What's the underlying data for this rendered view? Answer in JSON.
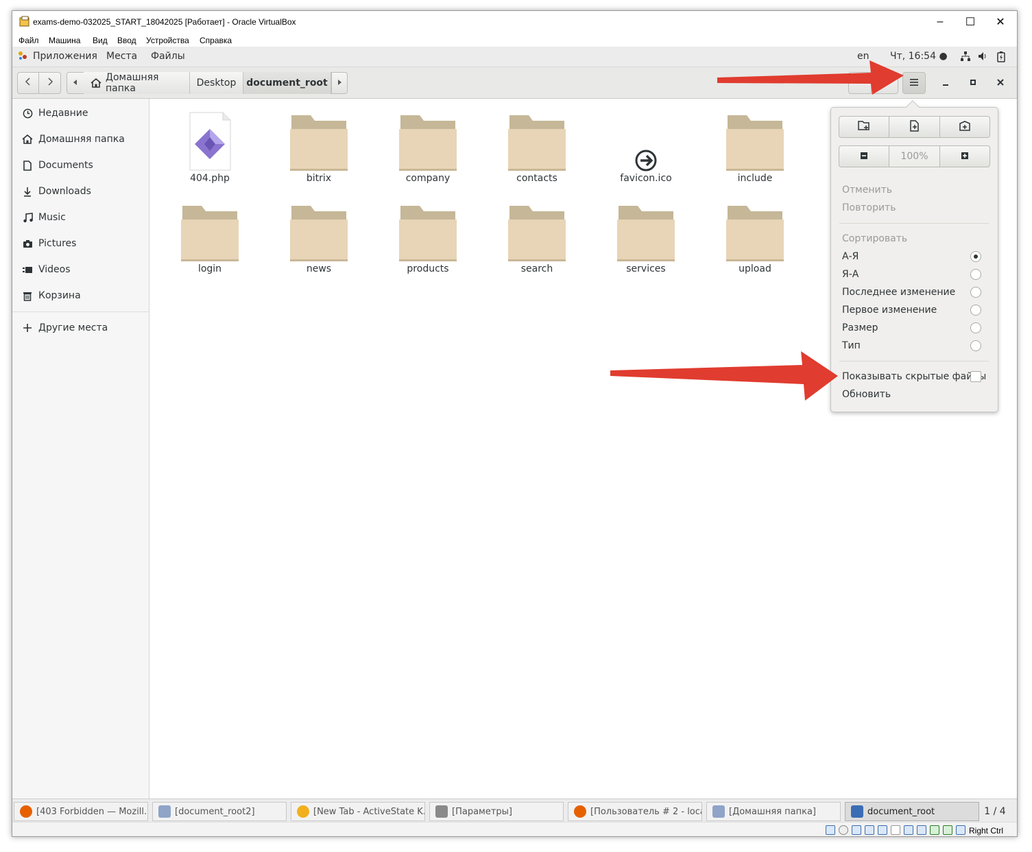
{
  "window": {
    "title": "exams-demo-032025_START_18042025 [Работает] - Oracle VirtualBox",
    "minimize": "–",
    "maximize": "☐",
    "close": "✕"
  },
  "vbox_menu": [
    "Файл",
    "Машина",
    "Вид",
    "Ввод",
    "Устройства",
    "Справка"
  ],
  "topbar": {
    "apps": "Приложения",
    "places": "Места",
    "files": "Файлы",
    "lang": "en",
    "clock": "Чт, 16:54 ●"
  },
  "header": {
    "crumbs": [
      "Домашняя папка",
      "Desktop",
      "document_root"
    ],
    "menu_icon": "hamburger-icon"
  },
  "sidebar": {
    "items": [
      {
        "label": "Недавние",
        "icon": "clock-icon"
      },
      {
        "label": "Домашняя папка",
        "icon": "home-icon"
      },
      {
        "label": "Documents",
        "icon": "document-icon"
      },
      {
        "label": "Downloads",
        "icon": "download-icon"
      },
      {
        "label": "Music",
        "icon": "music-icon"
      },
      {
        "label": "Pictures",
        "icon": "camera-icon"
      },
      {
        "label": "Videos",
        "icon": "video-icon"
      },
      {
        "label": "Корзина",
        "icon": "trash-icon"
      }
    ],
    "other": "Другие места"
  },
  "files": [
    {
      "name": "404.php",
      "type": "php"
    },
    {
      "name": "bitrix",
      "type": "folder"
    },
    {
      "name": "company",
      "type": "folder"
    },
    {
      "name": "contacts",
      "type": "folder"
    },
    {
      "name": "favicon.ico",
      "type": "ico"
    },
    {
      "name": "include",
      "type": "folder"
    },
    {
      "name": "login",
      "type": "folder"
    },
    {
      "name": "news",
      "type": "folder"
    },
    {
      "name": "products",
      "type": "folder"
    },
    {
      "name": "search",
      "type": "folder"
    },
    {
      "name": "services",
      "type": "folder"
    },
    {
      "name": "upload",
      "type": "folder"
    }
  ],
  "popover": {
    "zoom": "100%",
    "undo": "Отменить",
    "redo": "Повторить",
    "sort_header": "Сортировать",
    "sort_options": [
      {
        "label": "А-Я",
        "selected": true
      },
      {
        "label": "Я-А",
        "selected": false
      },
      {
        "label": "Последнее изменение",
        "selected": false
      },
      {
        "label": "Первое изменение",
        "selected": false
      },
      {
        "label": "Размер",
        "selected": false
      },
      {
        "label": "Тип",
        "selected": false
      }
    ],
    "show_hidden": "Показывать скрытые файлы",
    "show_hidden_checked": false,
    "reload": "Обновить"
  },
  "taskbar": {
    "tasks": [
      {
        "label": "[403 Forbidden — Mozill...",
        "color": "#e66000"
      },
      {
        "label": "[document_root2]",
        "color": "#8fa4c7"
      },
      {
        "label": "[New Tab - ActiveState K...",
        "color": "#f2b01e"
      },
      {
        "label": "[Параметры]",
        "color": "#8a8a8a"
      },
      {
        "label": "[Пользователь # 2 - loca...",
        "color": "#e66000"
      },
      {
        "label": "[Домашняя папка]",
        "color": "#8fa4c7"
      },
      {
        "label": "document_root",
        "color": "#3b6db5"
      }
    ],
    "pager": "1 / 4"
  },
  "statusbar": {
    "host_key": "Right Ctrl"
  },
  "colors": {
    "folder_back": "#c5b797",
    "folder_front": "#e8d5b7",
    "annotation": "#e03c2f"
  }
}
